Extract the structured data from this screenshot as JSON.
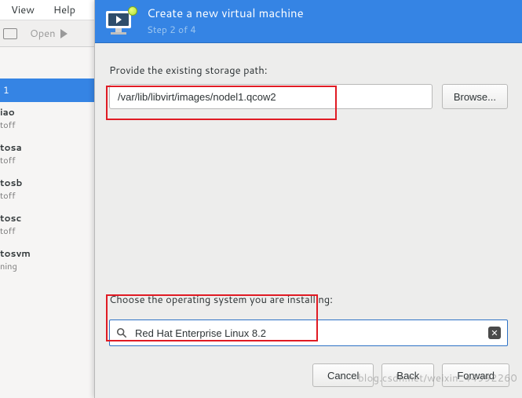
{
  "menubar": {
    "view": "View",
    "help": "Help"
  },
  "toolbar": {
    "open_label": "Open"
  },
  "vm_list": {
    "selected_label": "1",
    "items": [
      {
        "name": "iao",
        "state": "toff"
      },
      {
        "name": "tosa",
        "state": "toff"
      },
      {
        "name": "tosb",
        "state": "toff"
      },
      {
        "name": "tosc",
        "state": "toff"
      },
      {
        "name": "tosvm",
        "state": "ning"
      }
    ]
  },
  "dialog": {
    "title": "Create a new virtual machine",
    "step": "Step 2 of 4",
    "path_label": "Provide the existing storage path:",
    "path_value": "/var/lib/libvirt/images/nodel1.qcow2",
    "browse_label": "Browse...",
    "os_label": "Choose the operating system you are installing:",
    "os_value": "Red Hat Enterprise Linux 8.2",
    "cancel_label": "Cancel",
    "back_label": "Back",
    "forward_label": "Forward"
  },
  "watermark": "blog.csdn.net/weixin_44992260"
}
